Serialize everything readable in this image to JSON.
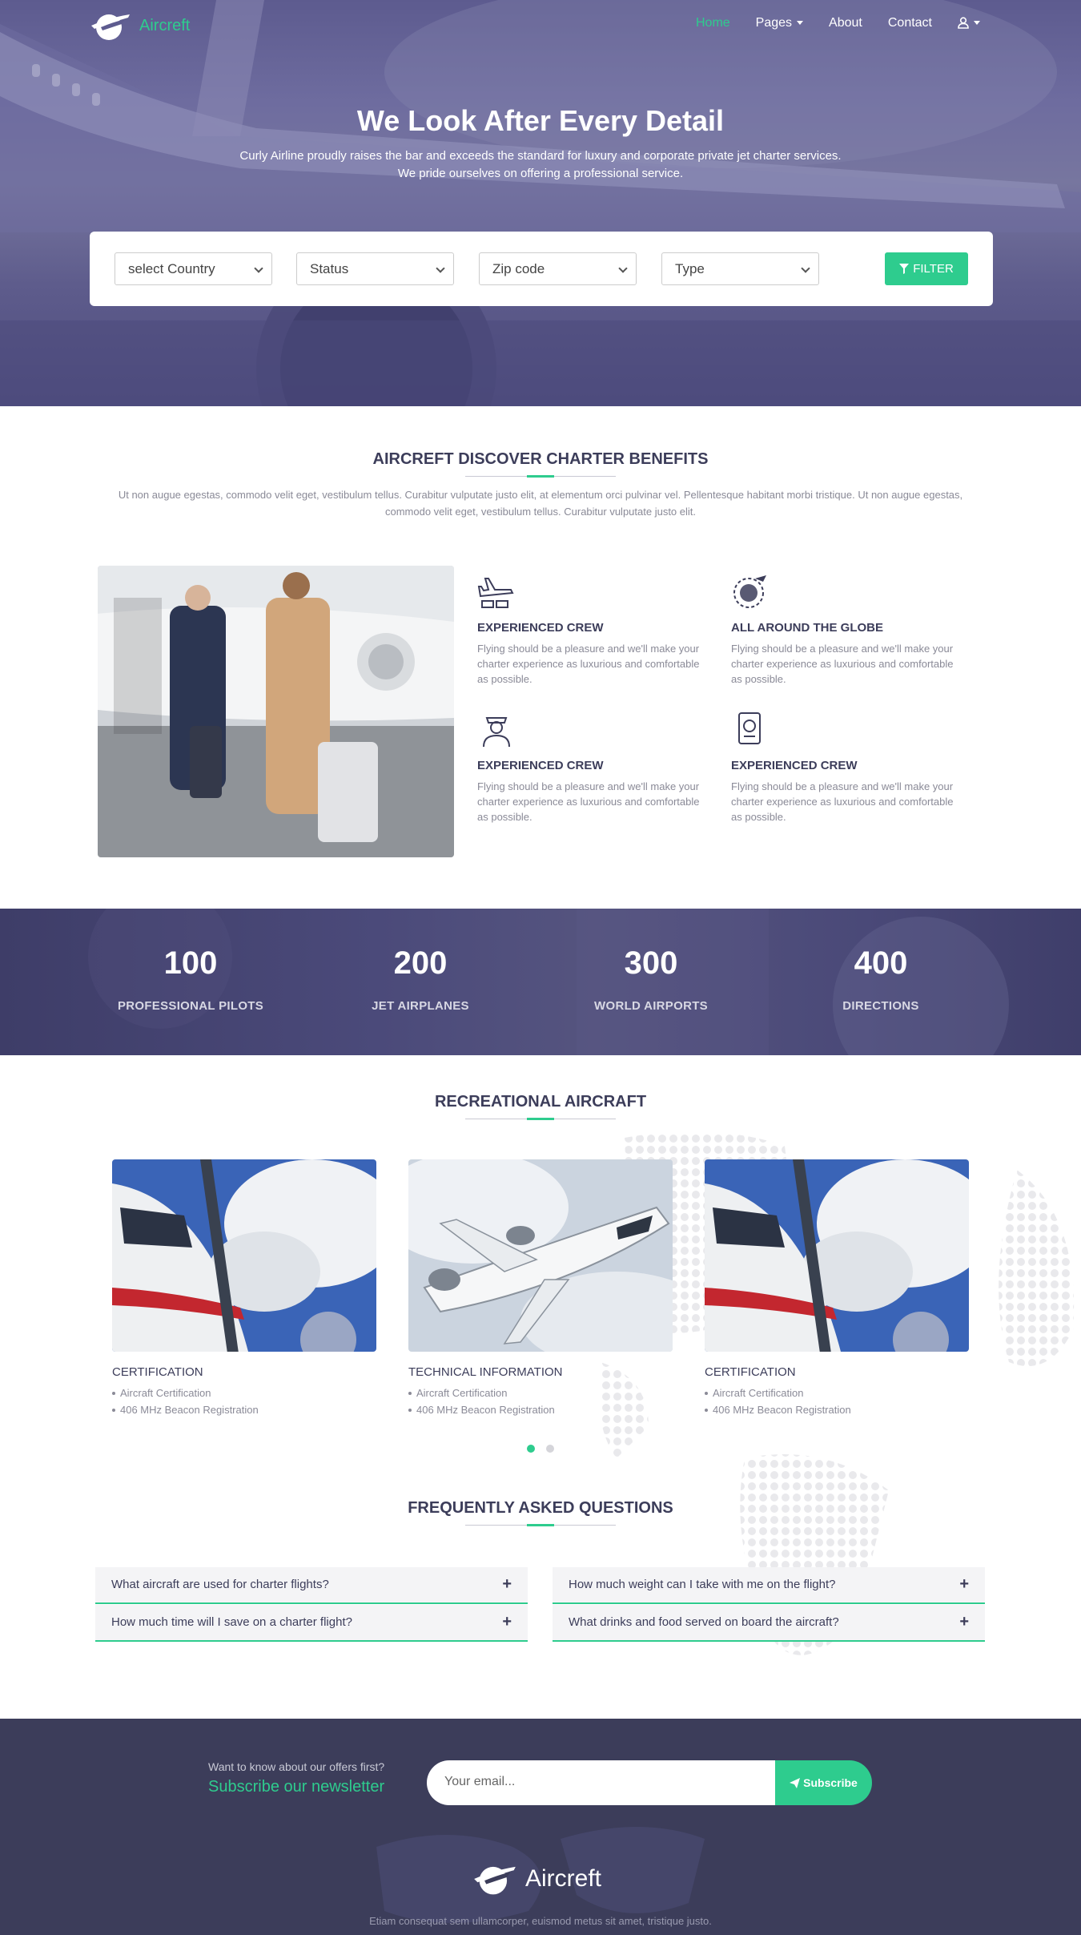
{
  "brand": {
    "name": "Aircreft"
  },
  "nav": {
    "items": [
      {
        "label": "Home",
        "active": true
      },
      {
        "label": "Pages",
        "dropdown": true
      },
      {
        "label": "About"
      },
      {
        "label": "Contact"
      }
    ],
    "user_icon": "user-icon"
  },
  "hero": {
    "title": "We Look After Every Detail",
    "subtitle": "Curly Airline proudly raises the bar and exceeds the standard for luxury and corporate private jet charter services. We pride ourselves on offering a professional service."
  },
  "filter": {
    "country": "select Country",
    "status": "Status",
    "zip": "Zip code",
    "type": "Type",
    "button": "FILTER"
  },
  "benefits": {
    "title": "AIRCREFT DISCOVER CHARTER BENEFITS",
    "intro": "Ut non augue egestas, commodo velit eget, vestibulum tellus. Curabitur vulputate justo elit, at elementum orci pulvinar vel. Pellentesque habitant morbi tristique. Ut non augue egestas, commodo velit eget, vestibulum tellus. Curabitur vulputate justo elit.",
    "features": [
      {
        "icon": "airplane-cargo-icon",
        "title": "EXPERIENCED CREW",
        "text": "Flying should be a pleasure and we'll make your charter experience as luxurious and comfortable as possible."
      },
      {
        "icon": "globe-plane-icon",
        "title": "ALL AROUND THE GLOBE",
        "text": "Flying should be a pleasure and we'll make your charter experience as luxurious and comfortable as possible."
      },
      {
        "icon": "pilot-icon",
        "title": "EXPERIENCED CREW",
        "text": "Flying should be a pleasure and we'll make your charter experience as luxurious and comfortable as possible."
      },
      {
        "icon": "passport-icon",
        "title": "EXPERIENCED CREW",
        "text": "Flying should be a pleasure and we'll make your charter experience as luxurious and comfortable as possible."
      }
    ]
  },
  "stats": [
    {
      "num": "100",
      "label": "PROFESSIONAL PILOTS"
    },
    {
      "num": "200",
      "label": "JET AIRPLANES"
    },
    {
      "num": "300",
      "label": "WORLD AIRPORTS"
    },
    {
      "num": "400",
      "label": "DIRECTIONS"
    }
  ],
  "aircraft": {
    "title": "RECREATIONAL AIRCRAFT",
    "cards": [
      {
        "title": "CERTIFICATION",
        "items": [
          "Aircraft Certification",
          "406 MHz Beacon Registration"
        ]
      },
      {
        "title": "TECHNICAL INFORMATION",
        "items": [
          "Aircraft Certification",
          "406 MHz Beacon Registration"
        ]
      },
      {
        "title": "CERTIFICATION",
        "items": [
          "Aircraft Certification",
          "406 MHz Beacon Registration"
        ]
      }
    ],
    "carousel_active": 0
  },
  "faq": {
    "title": "FREQUENTLY ASKED QUESTIONS",
    "items": [
      "What aircraft are used for charter flights?",
      "How much weight can I take with me on the flight?",
      "How much time will I save on a charter flight?",
      "What drinks and food served on board the aircraft?"
    ]
  },
  "newsletter": {
    "small": "Want to know about our offers first?",
    "big": "Subscribe our newsletter",
    "placeholder": "Your email...",
    "button": "Subscribe"
  },
  "footer": {
    "copy": "Etiam consequat sem ullamcorper, euismod metus sit amet, tristique justo."
  },
  "colors": {
    "accent": "#2ecc8e",
    "navy": "#3c3d5a",
    "hero": "#5d5b8f"
  }
}
